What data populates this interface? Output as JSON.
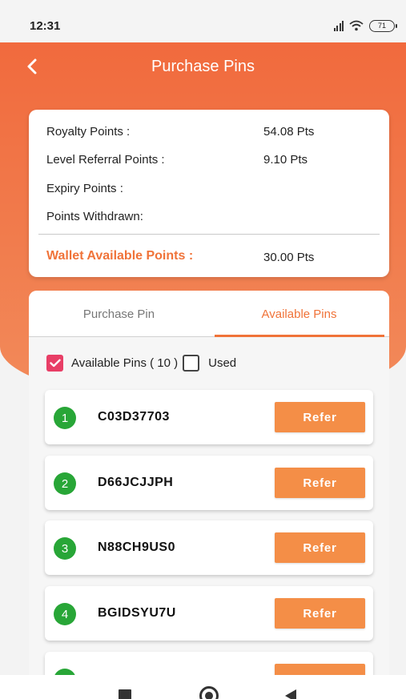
{
  "status_bar": {
    "time": "12:31",
    "battery": "71"
  },
  "header": {
    "title": "Purchase Pins"
  },
  "points": {
    "rows": [
      {
        "label": "Royalty Points :",
        "value": "54.08 Pts"
      },
      {
        "label": "Level Referral Points :",
        "value": "9.10 Pts"
      },
      {
        "label": "Expiry Points :",
        "value": ""
      },
      {
        "label": "Points Withdrawn:",
        "value": ""
      }
    ],
    "wallet": {
      "label": "Wallet Available Points :",
      "value": "30.00 Pts"
    }
  },
  "tabs": [
    {
      "label": "Purchase Pin",
      "active": false
    },
    {
      "label": "Available Pins",
      "active": true
    }
  ],
  "filters": {
    "available": {
      "label": "Available Pins ( 10 )",
      "checked": true
    },
    "used": {
      "label": "Used",
      "checked": false
    }
  },
  "pins": [
    {
      "number": "1",
      "code": "C03D37703",
      "action": "Refer"
    },
    {
      "number": "2",
      "code": "D66JCJJPH",
      "action": "Refer"
    },
    {
      "number": "3",
      "code": "N88CH9US0",
      "action": "Refer"
    },
    {
      "number": "4",
      "code": "BGIDSYU7U",
      "action": "Refer"
    },
    {
      "number": "",
      "code": "",
      "action": ""
    }
  ],
  "colors": {
    "accent": "#f07339",
    "refer_button": "#f48e47",
    "pin_badge": "#28a637",
    "checkbox_on": "#e83e66"
  },
  "nav_icons": [
    "recent-apps-icon",
    "home-icon",
    "back-icon"
  ]
}
